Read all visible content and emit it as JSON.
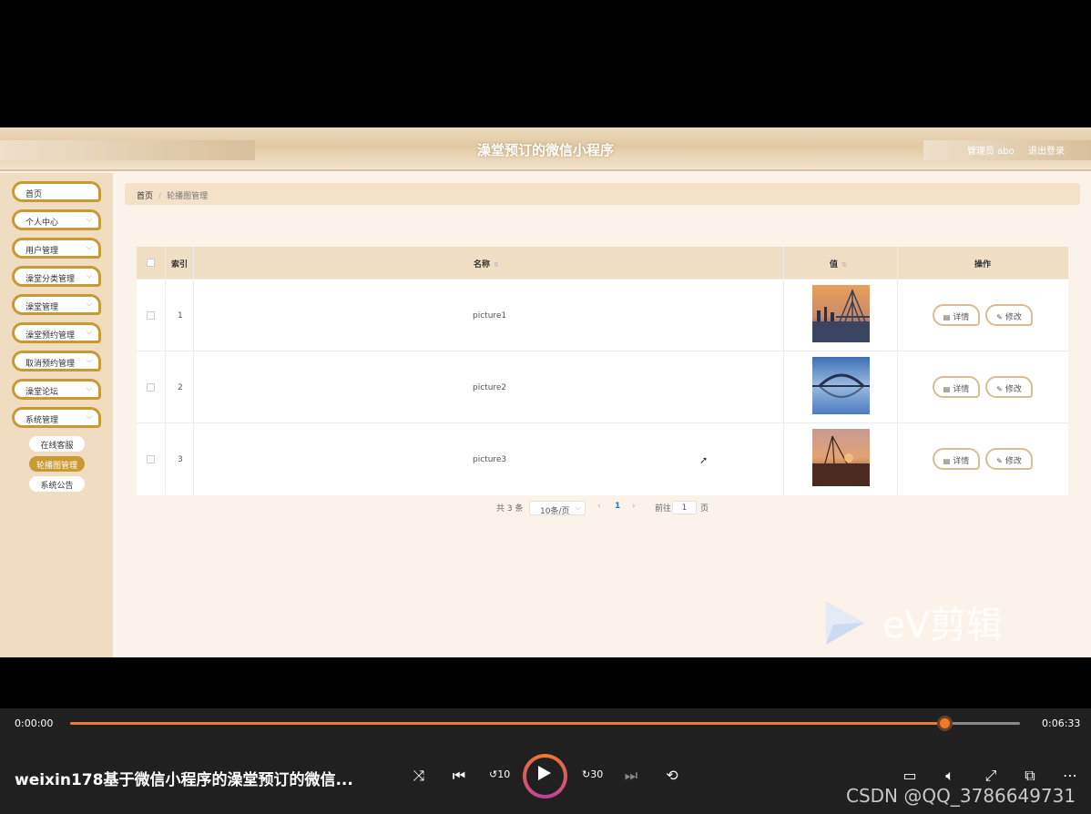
{
  "app": {
    "title": "澡堂预订的微信小程序",
    "admin_label": "管理员 abo",
    "logout": "退出登录"
  },
  "sidebar": {
    "items": [
      {
        "label": "首页",
        "has_chevron": false
      },
      {
        "label": "个人中心",
        "has_chevron": true
      },
      {
        "label": "用户管理",
        "has_chevron": true
      },
      {
        "label": "澡堂分类管理",
        "has_chevron": true
      },
      {
        "label": "澡堂管理",
        "has_chevron": true
      },
      {
        "label": "澡堂预约管理",
        "has_chevron": true
      },
      {
        "label": "取消预约管理",
        "has_chevron": true
      },
      {
        "label": "澡堂论坛",
        "has_chevron": true
      },
      {
        "label": "系统管理",
        "has_chevron": true
      }
    ],
    "submenu": [
      {
        "label": "在线客服",
        "active": false
      },
      {
        "label": "轮播图管理",
        "active": true
      },
      {
        "label": "系统公告",
        "active": false
      }
    ]
  },
  "breadcrumb": {
    "home": "首页",
    "sep": "/",
    "current": "轮播图管理"
  },
  "table": {
    "headers": {
      "index": "索引",
      "name": "名称",
      "value": "值",
      "actions": "操作"
    },
    "rows": [
      {
        "index": "1",
        "name": "picture1",
        "image": "bridge-at-dusk"
      },
      {
        "index": "2",
        "name": "picture2",
        "image": "arch-bridge-blue-sky"
      },
      {
        "index": "3",
        "name": "picture3",
        "image": "harbor-sunset"
      }
    ],
    "detail_label": "详情",
    "edit_label": "修改"
  },
  "pagination": {
    "total": "共 3 条",
    "page_size": "10条/页",
    "current_page": "1",
    "goto_label": "前往",
    "goto_value": "1",
    "page_unit": "页"
  },
  "watermark": {
    "text": "eV剪辑"
  },
  "player": {
    "current_time": "0:00:00",
    "total_time": "0:06:33",
    "progress": 0.92,
    "title": "weixin178基于微信小程序的澡堂预订的微信...",
    "rewind_label": "10",
    "forward_label": "30",
    "overlay": "CSDN @QQ_3786649731"
  },
  "colors": {
    "accent": "#c99a33",
    "header_bg": "#f1dfc5",
    "progress": "#f07a2a"
  }
}
